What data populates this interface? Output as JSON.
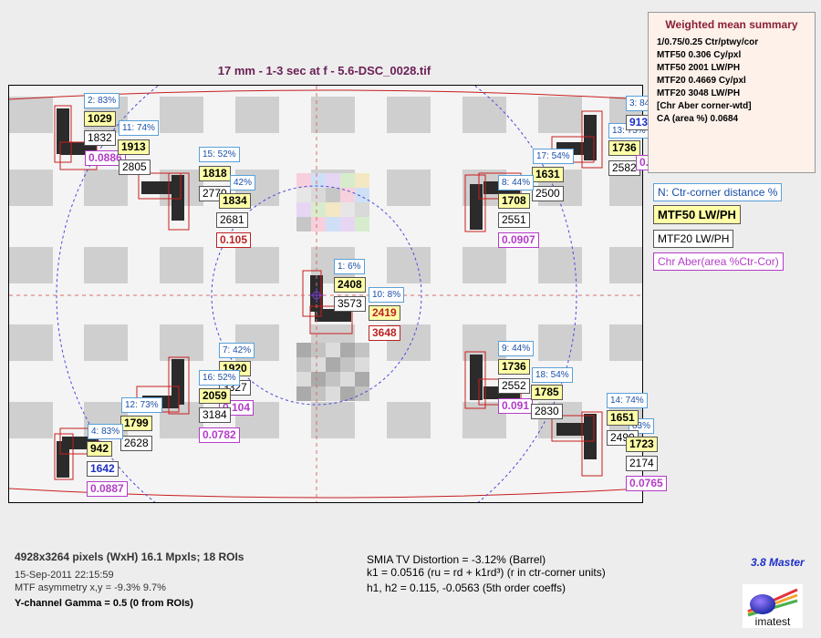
{
  "title": "17 mm - 1-3 sec at f - 5.6-DSC_0028.tif",
  "summary": {
    "title": "Weighted mean summary",
    "lines": [
      "1/0.75/0.25 Ctr/ptwy/cor",
      "MTF50  0.306 Cy/pxl",
      "MTF50  2001 LW/PH",
      "MTF20  0.4669 Cy/pxl",
      "MTF20  3048 LW/PH",
      "[Chr Aber corner-wtd]",
      "CA (area %)  0.0684"
    ]
  },
  "legend": {
    "n": "N:  Ctr-corner distance %",
    "mtf50": "MTF50  LW/PH",
    "mtf20": "MTF20  LW/PH",
    "ca": "Chr Aber(area %Ctr-Cor)"
  },
  "footer": {
    "pixels": "4928x3264 pixels (WxH)  16.1 Mpxls;  18 ROIs",
    "date": "15-Sep-2011 22:15:59",
    "asym": "MTF asymmetry x,y = -9.3%  9.7%",
    "gamma": "Y-channel    Gamma = 0.5  (0 from ROIs)",
    "dist": "SMIA TV Distortion = -3.12%  (Barrel)",
    "k1": "k1 = 0.0516  (ru = rd + k1rd³)  (r in ctr-corner units)",
    "h": "h1, h2 = 0.115,  -0.0563  (5th order coeffs)",
    "version": "3.8 Master",
    "logo": "imatest"
  },
  "chart_data": {
    "type": "table",
    "title": "17 mm - 1-3 sec at f - 5.6-DSC_0028.tif",
    "columns": [
      "ROI",
      "Ctr-corner distance %",
      "MTF50 LW/PH",
      "MTF20 LW/PH",
      "Chr Aber (area %)"
    ],
    "rois": [
      {
        "label": "1: 6%",
        "mtf50": "2408",
        "mtf20": "3573",
        "ca": ""
      },
      {
        "label": "2: 83%",
        "mtf50": "1029",
        "mtf20": "1832",
        "ca": "0.0886"
      },
      {
        "label": "3: 84",
        "mtf50": "913",
        "mtf20": "",
        "ca": ""
      },
      {
        "label": "4: 83%",
        "mtf50": "942",
        "mtf20": "1642",
        "ca": "0.0887"
      },
      {
        "label": "7: 42%",
        "mtf50": "1920",
        "mtf20": "3327",
        "ca": "0.104"
      },
      {
        "label": "8: 44%",
        "mtf50": "1708",
        "mtf20": "2551",
        "ca": "0.0907"
      },
      {
        "label": "9: 44%",
        "mtf50": "1736",
        "mtf20": "2552",
        "ca": "0.091"
      },
      {
        "label": "10: 8%",
        "mtf50": "2419",
        "mtf20": "3648",
        "ca": ""
      },
      {
        "label": "11: 74%",
        "mtf50": "1913",
        "mtf20": "2805",
        "ca": ""
      },
      {
        "label": "12: 73%",
        "mtf50": "1799",
        "mtf20": "2628",
        "ca": ""
      },
      {
        "label": "13: 75%",
        "mtf50": "1736",
        "mtf20": "2582",
        "ca": "0.07"
      },
      {
        "label": "14: 74%",
        "mtf50": "1651",
        "mtf20": "2490",
        "ca": ""
      },
      {
        "label": "15: 52%",
        "mtf50": "1818",
        "mtf20": "2770",
        "ca": ""
      },
      {
        "label": "16: 52%",
        "mtf50": "2059",
        "mtf20": "3184",
        "ca": "0.0782"
      },
      {
        "label": "17: 54%",
        "mtf50": "1631",
        "mtf20": "2500",
        "ca": ""
      },
      {
        "label": "18: 54%",
        "mtf50": "1785",
        "mtf20": "2830",
        "ca": ""
      },
      {
        "label": "42%",
        "mtf50": "1834",
        "mtf20": "2681",
        "ca": "0.105"
      },
      {
        "label": "83%",
        "mtf50": "1723",
        "mtf20": "2174",
        "ca": "0.0765"
      }
    ]
  }
}
